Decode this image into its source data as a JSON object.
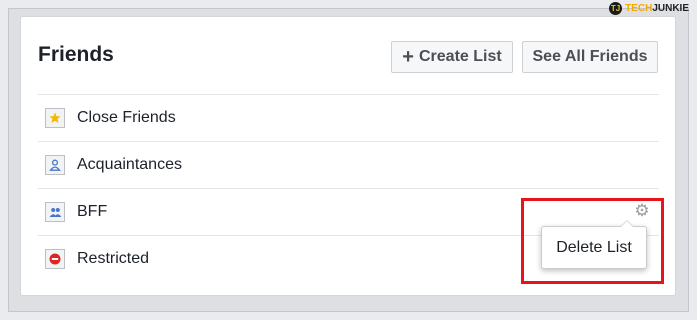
{
  "watermark": {
    "prefix": "TECH",
    "suffix": "JUNKIE"
  },
  "friends": {
    "title": "Friends",
    "create_list_label": "Create List",
    "see_all_label": "See All Friends",
    "lists": [
      {
        "label": "Close Friends",
        "icon": "star-icon"
      },
      {
        "label": "Acquaintances",
        "icon": "acquaintance-icon"
      },
      {
        "label": "BFF",
        "icon": "people-icon"
      },
      {
        "label": "Restricted",
        "icon": "restricted-icon"
      }
    ]
  },
  "popup": {
    "delete_label": "Delete List"
  },
  "colors": {
    "highlight": "#e8141b",
    "star": "#f5b800",
    "restricted": "#e02424",
    "blue_icon": "#4a76c9"
  }
}
